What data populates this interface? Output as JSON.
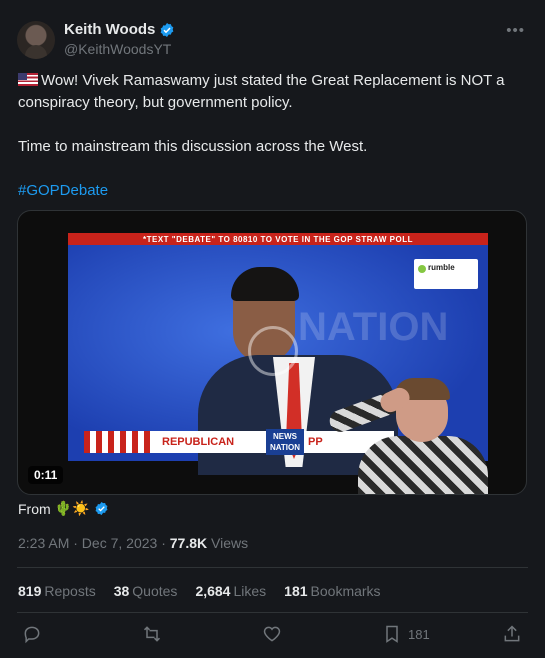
{
  "author": {
    "display_name": "Keith Woods",
    "handle": "@KeithWoodsYT",
    "verified": true
  },
  "more_icon": "more-horizontal-icon",
  "tweet": {
    "line1": "Wow! Vivek Ramaswamy just stated the Great Replacement is NOT a conspiracy theory, but government policy.",
    "line2": "Time to mainstream this discussion across the West.",
    "hashtag": "#GOPDebate"
  },
  "media": {
    "banner_text": "*TEXT \"DEBATE\" TO 80810 TO VOTE IN THE GOP STRAW POLL",
    "watermark": "NATION",
    "overlay_logo": "rumble",
    "lower_third_left": "REPUBLICAN",
    "lower_third_news": "NEWS NATION",
    "lower_third_right": "PP",
    "duration": "0:11"
  },
  "from": {
    "label": "From",
    "emoji": "🌵☀️"
  },
  "meta": {
    "time": "2:23 AM · Dec 7, 2023 · ",
    "views_count": "77.8K",
    "views_label": " Views"
  },
  "stats": {
    "reposts_count": "819",
    "reposts_label": "Reposts",
    "quotes_count": "38",
    "quotes_label": "Quotes",
    "likes_count": "2,684",
    "likes_label": "Likes",
    "bookmarks_count": "181",
    "bookmarks_label": "Bookmarks"
  },
  "actions": {
    "bookmark_count": "181"
  },
  "colors": {
    "background": "#16181c",
    "text": "#e7e9ea",
    "muted": "#71767b",
    "accent": "#1d9bf0"
  }
}
